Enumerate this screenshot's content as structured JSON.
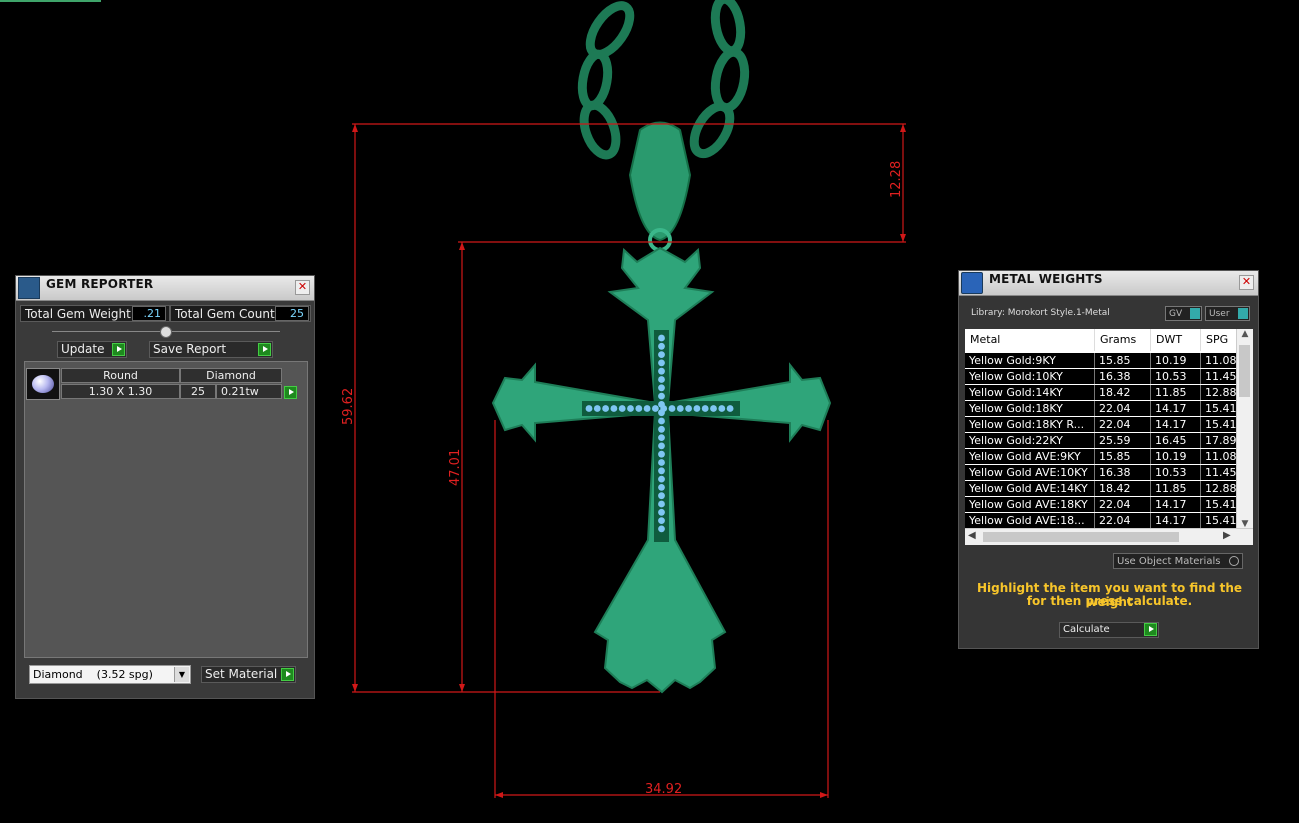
{
  "gem_reporter": {
    "title": "GEM REPORTER",
    "total_gem_weight_label": "Total Gem Weight",
    "total_gem_weight_value": ".21",
    "total_gem_count_label": "Total Gem Count",
    "total_gem_count_value": "25",
    "update_label": "Update",
    "save_report_label": "Save Report",
    "gem": {
      "shape": "Round",
      "size": "1.30 X 1.30",
      "material": "Diamond",
      "count": "25",
      "weight": "0.21tw"
    },
    "material_select": "Diamond    (3.52 spg)",
    "set_material_label": "Set Material"
  },
  "metal_weights": {
    "title": "METAL WEIGHTS",
    "library_label": "Library: Morokort Style.1-Metal",
    "gv_label": "GV",
    "user_label": "User",
    "columns": [
      "Metal",
      "Grams",
      "DWT",
      "SPG"
    ],
    "rows": [
      [
        "Yellow Gold:9KY",
        "15.85",
        "10.19",
        "11.08"
      ],
      [
        "Yellow Gold:10KY",
        "16.38",
        "10.53",
        "11.45"
      ],
      [
        "Yellow Gold:14KY",
        "18.42",
        "11.85",
        "12.88"
      ],
      [
        "Yellow Gold:18KY",
        "22.04",
        "14.17",
        "15.41"
      ],
      [
        "Yellow Gold:18KY R...",
        "22.04",
        "14.17",
        "15.41"
      ],
      [
        "Yellow Gold:22KY",
        "25.59",
        "16.45",
        "17.89"
      ],
      [
        "Yellow Gold AVE:9KY",
        "15.85",
        "10.19",
        "11.08"
      ],
      [
        "Yellow Gold AVE:10KY",
        "16.38",
        "10.53",
        "11.45"
      ],
      [
        "Yellow Gold AVE:14KY",
        "18.42",
        "11.85",
        "12.88"
      ],
      [
        "Yellow Gold AVE:18KY",
        "22.04",
        "14.17",
        "15.41"
      ],
      [
        "Yellow Gold AVE:18...",
        "22.04",
        "14.17",
        "15.41"
      ]
    ],
    "use_object_materials_label": "Use Object Materials",
    "hint_line1": "Highlight the item you want to find the weight",
    "hint_line2": "for then press calculate.",
    "calculate_label": "Calculate"
  },
  "dimensions": {
    "bail_height": "12.28",
    "total_height": "59.62",
    "cross_height": "47.01",
    "cross_width": "34.92"
  },
  "colors": {
    "model": "#2fa57a",
    "dimension": "#e02020",
    "stones": "#7fc6f2",
    "hint": "#f7c52a"
  }
}
